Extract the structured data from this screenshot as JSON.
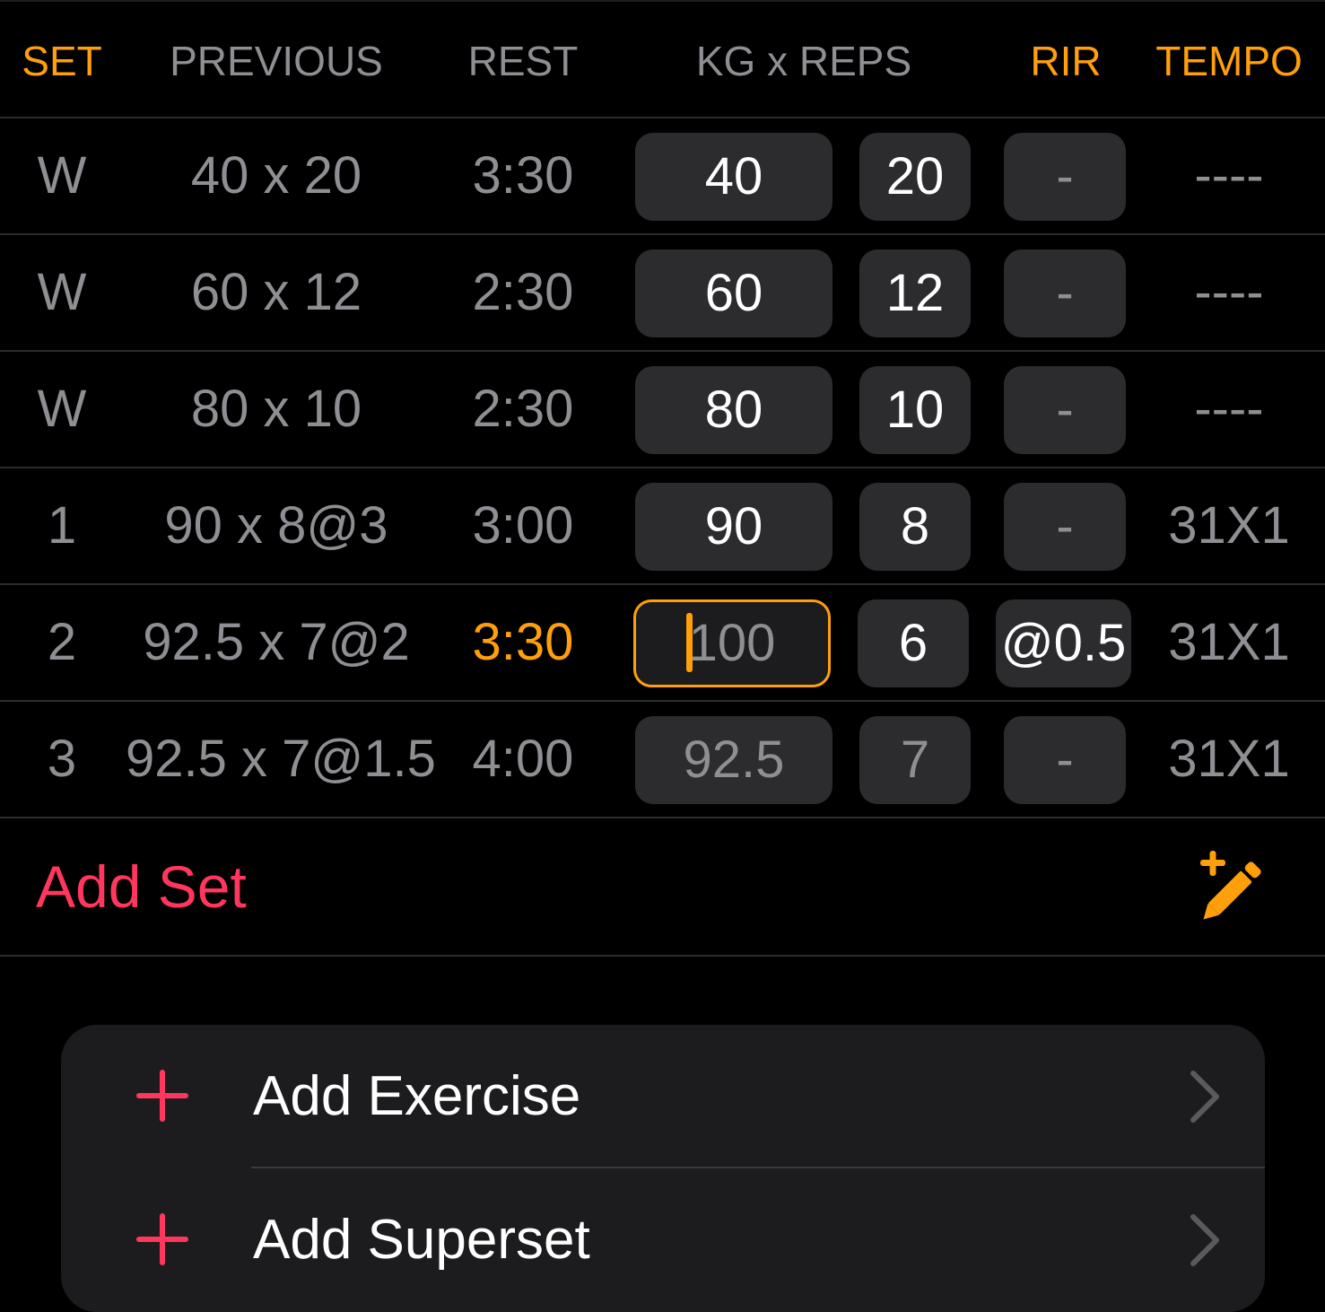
{
  "colors": {
    "accent": "#ff9f0a",
    "destructive": "#ff375f",
    "cell_bg": "#2c2c2e",
    "card_bg": "#1c1c1e",
    "muted_text": "#8e8e93"
  },
  "header": {
    "set": "SET",
    "previous": "PREVIOUS",
    "rest": "REST",
    "kg_reps": "KG x REPS",
    "rir": "RIR",
    "tempo": "TEMPO"
  },
  "rows": [
    {
      "set": "W",
      "previous": "40 x 20",
      "rest": "3:30",
      "kg": "40",
      "reps": "20",
      "rir": "-",
      "tempo": "----"
    },
    {
      "set": "W",
      "previous": "60 x 12",
      "rest": "2:30",
      "kg": "60",
      "reps": "12",
      "rir": "-",
      "tempo": "----"
    },
    {
      "set": "W",
      "previous": "80 x 10",
      "rest": "2:30",
      "kg": "80",
      "reps": "10",
      "rir": "-",
      "tempo": "----"
    },
    {
      "set": "1",
      "previous": "90 x 8@3",
      "rest": "3:00",
      "kg": "90",
      "reps": "8",
      "rir": "-",
      "tempo": "31X1"
    },
    {
      "set": "2",
      "previous": "92.5 x 7@2",
      "rest": "3:30",
      "kg_placeholder": "100",
      "reps": "6",
      "rir": "@0.5",
      "tempo": "31X1"
    },
    {
      "set": "3",
      "previous": "92.5 x 7@1.5",
      "rest": "4:00",
      "kg_placeholder": "92.5",
      "reps_placeholder": "7",
      "rir": "-",
      "tempo": "31X1"
    }
  ],
  "add_set": {
    "label": "Add Set",
    "icon": "pencil-plus-icon"
  },
  "menu": {
    "items": [
      {
        "label": "Add Exercise",
        "icon": "plus-icon",
        "trailing_icon": "chevron-right-icon"
      },
      {
        "label": "Add Superset",
        "icon": "plus-icon",
        "trailing_icon": "chevron-right-icon"
      }
    ]
  }
}
